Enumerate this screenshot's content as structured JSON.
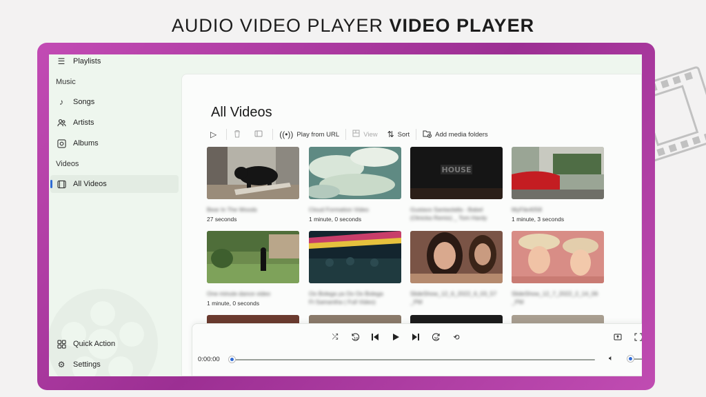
{
  "banner": {
    "light": "AUDIO VIDEO PLAYER",
    "bold": "VIDEO PLAYER"
  },
  "sidebar": {
    "playlists": "Playlists",
    "music_label": "Music",
    "songs": "Songs",
    "artists": "Artists",
    "albums": "Albums",
    "videos_label": "Videos",
    "all_videos": "All Videos",
    "quick_action": "Quick Action",
    "settings": "Settings"
  },
  "main": {
    "title": "All Videos",
    "toolbar": {
      "play_from_url": "Play from URL",
      "view": "View",
      "sort": "Sort",
      "add_media_folders": "Add media folders"
    },
    "videos": [
      {
        "title": "Bear In The Woods",
        "subtitle": "",
        "duration": "27 seconds",
        "theme": "bear"
      },
      {
        "title": "Cloud Formation Video",
        "subtitle": "",
        "duration": "1 minute, 0 seconds",
        "theme": "clouds"
      },
      {
        "title": "Gustavo Santaolalla - Babel",
        "subtitle": "(Otnicka Remix) _ Tom Hardy",
        "duration": "",
        "theme": "house"
      },
      {
        "title": "MyFile4058",
        "subtitle": "",
        "duration": "1 minute, 3 seconds",
        "theme": "car"
      },
      {
        "title": "One minute dance video",
        "subtitle": "",
        "duration": "1 minute, 0 seconds",
        "theme": "dance"
      },
      {
        "title": "Oo Bolega ya Oo Oo Bolega",
        "subtitle": "Ft Samantha ( Full Video)",
        "duration": "",
        "theme": "party"
      },
      {
        "title": "SlideShow_12_6_2022_6_03_57",
        "subtitle": "_PM",
        "duration": "",
        "theme": "girl1"
      },
      {
        "title": "SlideShow_12_7_2022_2_14_06",
        "subtitle": "_PM",
        "duration": "",
        "theme": "girls2"
      }
    ]
  },
  "player": {
    "time": "0:00:00",
    "progress": 0,
    "volume": 0.1
  },
  "colors": {
    "frame": "#b23fa6",
    "accent": "#2f6bd4",
    "window_bg": "#eef6ee"
  }
}
